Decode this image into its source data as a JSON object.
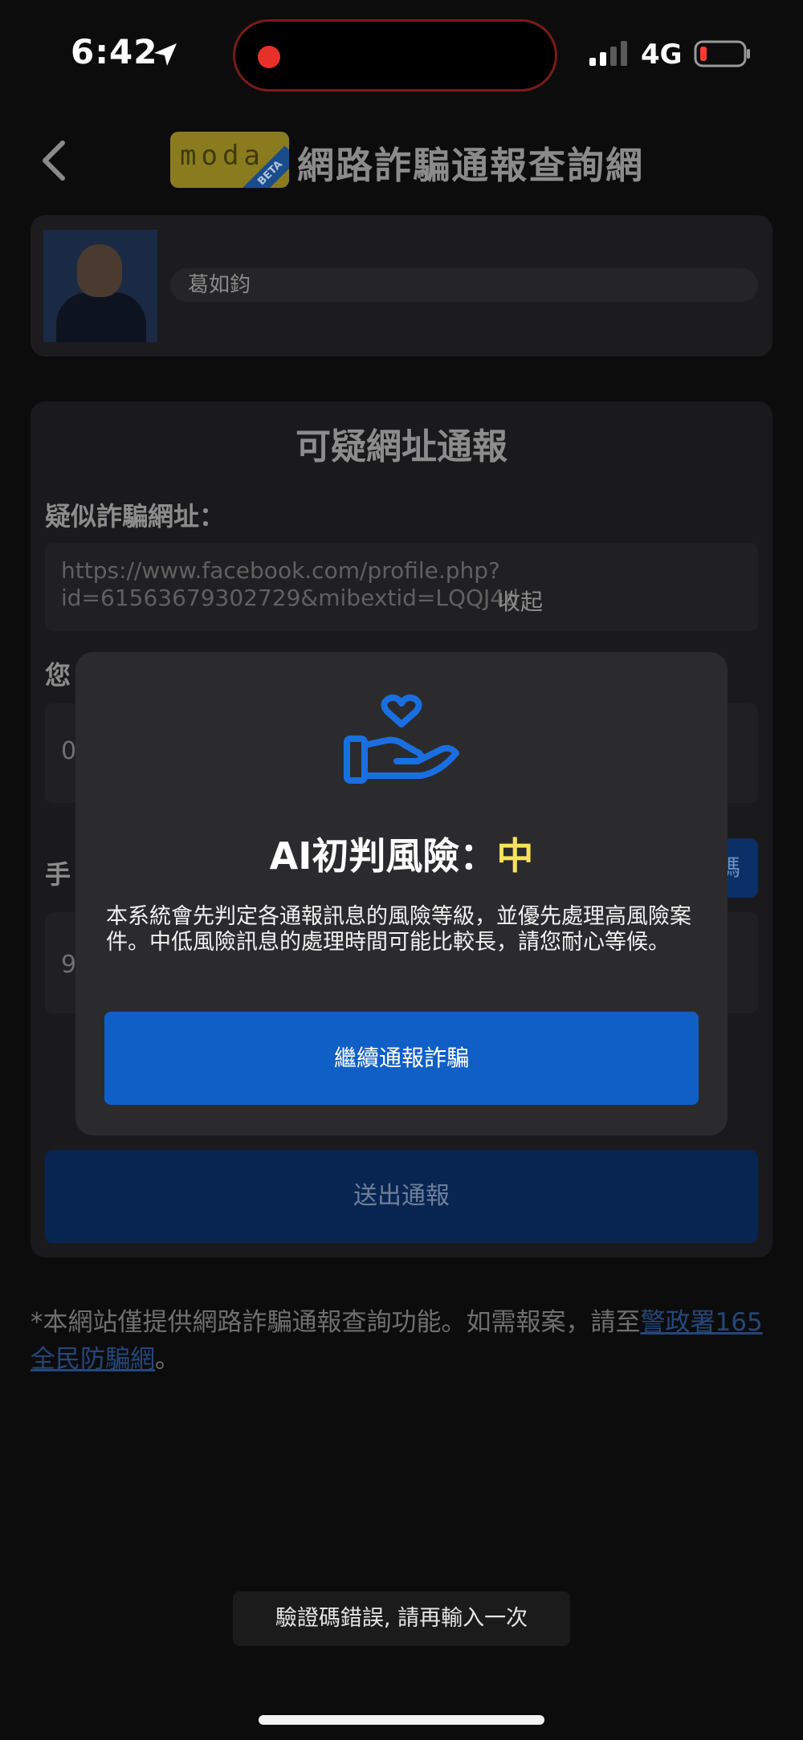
{
  "status_bar": {
    "time": "6:42",
    "network": "4G"
  },
  "header": {
    "logo_text": "moda",
    "logo_badge": "BETA",
    "title": "網路詐騙通報查詢網"
  },
  "profile": {
    "name": "葛如鈞"
  },
  "form": {
    "title": "可疑網址通報",
    "url_label": "疑似詐騙網址：",
    "url_value": "https://www.facebook.com/profile.php?id=61563679302729&mibextid=LQQJ4d",
    "url_toggle": "收起",
    "obscured_label_1": "您",
    "obscured_value_1": "0",
    "obscured_label_2": "手",
    "obscured_button": "碼",
    "obscured_value_2": "9",
    "submit_label": "送出通報"
  },
  "disclaimer": {
    "text": "*本網站僅提供網路詐騙通報查詢功能。如需報案，請至",
    "link_text": "警政署165全民防騙網",
    "suffix": "。"
  },
  "modal": {
    "icon": "hand-heart-icon",
    "title_prefix": "AI初判風險：",
    "risk_level": "中",
    "body": "本系統會先判定各通報訊息的風險等級，並優先處理高風險案件。中低風險訊息的處理時間可能比較長，請您耐心等候。",
    "button_label": "繼續通報詐騙"
  },
  "toast": {
    "message": "驗證碼錯誤, 請再輸入一次"
  },
  "colors": {
    "accent": "#0f5fc6",
    "risk_medium": "#f6e35a",
    "modal_bg": "#2b2b2d"
  }
}
